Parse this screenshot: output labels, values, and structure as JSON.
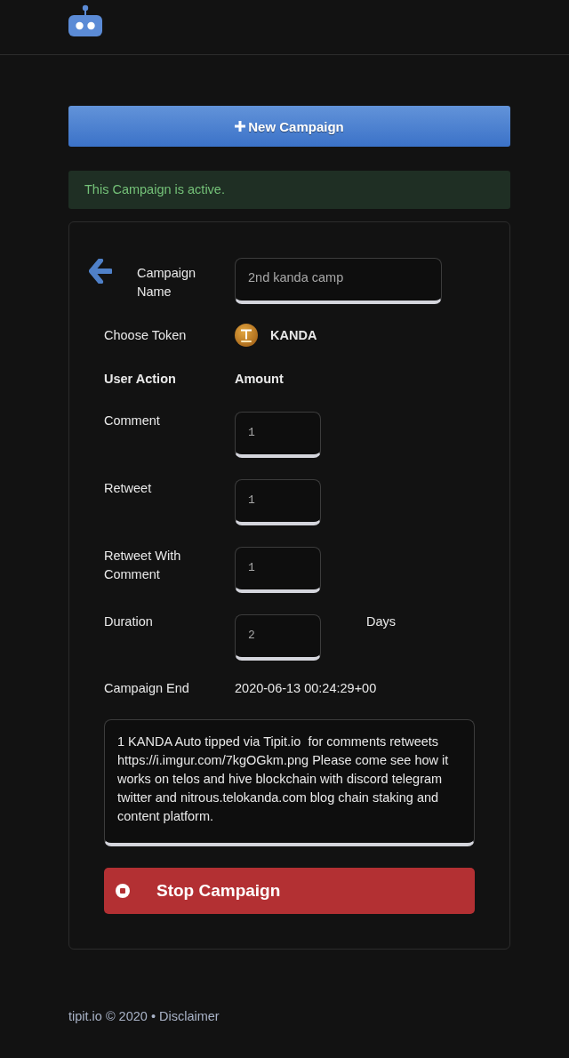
{
  "new_campaign_button": {
    "label": "New Campaign"
  },
  "alert": {
    "text": "This Campaign is active."
  },
  "form": {
    "campaign_name": {
      "label": "Campaign Name",
      "value": "2nd kanda camp"
    },
    "token": {
      "label": "Choose Token",
      "name": "KANDA"
    },
    "columns": [
      "User Action",
      "Amount"
    ],
    "actions": [
      {
        "label": "Comment",
        "value": "1"
      },
      {
        "label": "Retweet",
        "value": "1"
      },
      {
        "label": "Retweet With Comment",
        "value": "1"
      }
    ],
    "duration": {
      "label": "Duration",
      "value": "2",
      "unit": "Days"
    },
    "campaign_end": {
      "label": "Campaign End",
      "value": "2020-06-13 00:24:29+00"
    },
    "message": "1 KANDA Auto tipped via Tipit.io  for comments retweets https://i.imgur.com/7kgOGkm.png Please come see how it works on telos and hive blockchain with discord telegram twitter and nitrous.telokanda.com blog chain staking and content platform.",
    "stop_button": {
      "label": "Stop Campaign"
    }
  },
  "footer": {
    "text": "tipit.io © 2020 •",
    "link": "Disclaimer"
  }
}
